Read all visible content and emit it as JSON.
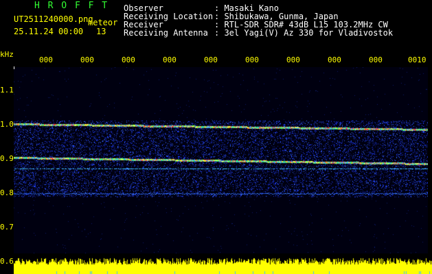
{
  "brand": {
    "title": "H R O F F T"
  },
  "file": {
    "name": "UT2511240000.png",
    "kind": "meteor",
    "datetime": "25.11.24 00:00",
    "count": "13"
  },
  "info": [
    {
      "label": "Observer",
      "value": ": Masaki Kano"
    },
    {
      "label": "Receiving Location",
      "value": ": Shibukawa, Gunma, Japan"
    },
    {
      "label": "Receiver",
      "value": ": RTL-SDR SDR# 43dB L15 103.2MHz CW"
    },
    {
      "label": "Receiving Antenna",
      "value": ": 3el Yagi(V) Az 330 for Vladivostok"
    }
  ],
  "axis": {
    "unit": "kHz",
    "freq_ticks": [
      "1.1",
      "1.0",
      "0.9",
      "0.8",
      "0.7",
      "0.6"
    ],
    "time_ticks": [
      "000",
      "000",
      "000",
      "000",
      "000",
      "000",
      "000",
      "000",
      "000",
      "0010"
    ]
  },
  "colors": {
    "text_primary": "#ffff00",
    "text_secondary": "#ffffff",
    "brand": "#33ff33",
    "noise": "#1e3cff",
    "signal": "#ff3030",
    "bar": "#ffff00"
  }
}
